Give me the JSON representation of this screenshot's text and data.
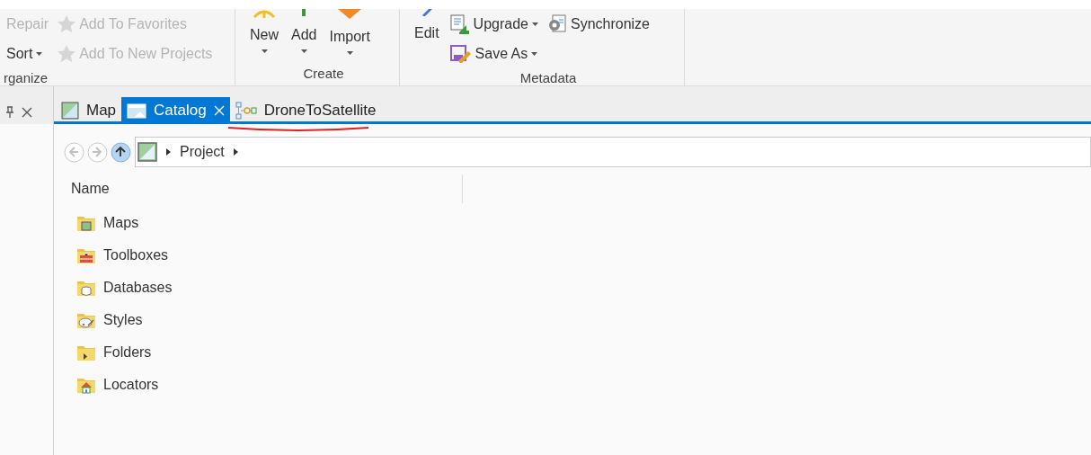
{
  "ribbon": {
    "groups": [
      {
        "label": "rganize",
        "columns": [
          [
            {
              "kind": "plain",
              "label": "Repair",
              "disabled": true,
              "dropdown": false
            },
            {
              "kind": "plain",
              "label": "Sort",
              "disabled": false,
              "dropdown": true
            }
          ],
          [
            {
              "kind": "star",
              "label": "Add To Favorites",
              "disabled": true,
              "dropdown": false
            },
            {
              "kind": "star",
              "label": "Add To New Projects",
              "disabled": true,
              "dropdown": false
            }
          ]
        ]
      },
      {
        "label": "Create",
        "columns": [
          [
            {
              "kind": "new",
              "label": "New",
              "disabled": false,
              "dropdown": true
            }
          ],
          [
            {
              "kind": "add",
              "label": "Add",
              "disabled": false,
              "dropdown": true
            }
          ],
          [
            {
              "kind": "import",
              "label": "Import",
              "disabled": false,
              "dropdown": true
            }
          ]
        ]
      },
      {
        "label": "Metadata",
        "columns": [
          [
            {
              "kind": "edit",
              "label": "Edit",
              "disabled": false,
              "dropdown": false
            }
          ],
          [
            {
              "kind": "upgrade",
              "label": "Upgrade",
              "disabled": false,
              "dropdown": true
            },
            {
              "kind": "saveas",
              "label": "Save As",
              "disabled": false,
              "dropdown": true
            }
          ],
          [
            {
              "kind": "sync",
              "label": "Synchronize",
              "disabled": false,
              "dropdown": false
            }
          ]
        ]
      }
    ]
  },
  "tabs": [
    {
      "kind": "map",
      "label": "Map",
      "selected": false,
      "closable": false,
      "underlined": false
    },
    {
      "kind": "catalog",
      "label": "Catalog",
      "selected": true,
      "closable": true,
      "underlined": false
    },
    {
      "kind": "model",
      "label": "DroneToSatellite",
      "selected": false,
      "closable": false,
      "underlined": true
    }
  ],
  "nav": {
    "buttons": [
      {
        "kind": "back",
        "disabled": true
      },
      {
        "kind": "forward",
        "disabled": true
      },
      {
        "kind": "up",
        "disabled": false
      }
    ],
    "path": [
      "Project"
    ]
  },
  "table": {
    "columns": [
      "Name"
    ],
    "rows": [
      {
        "kind": "maps",
        "name": "Maps"
      },
      {
        "kind": "toolboxes",
        "name": "Toolboxes"
      },
      {
        "kind": "databases",
        "name": "Databases"
      },
      {
        "kind": "styles",
        "name": "Styles"
      },
      {
        "kind": "folders",
        "name": "Folders"
      },
      {
        "kind": "locators",
        "name": "Locators"
      }
    ]
  }
}
